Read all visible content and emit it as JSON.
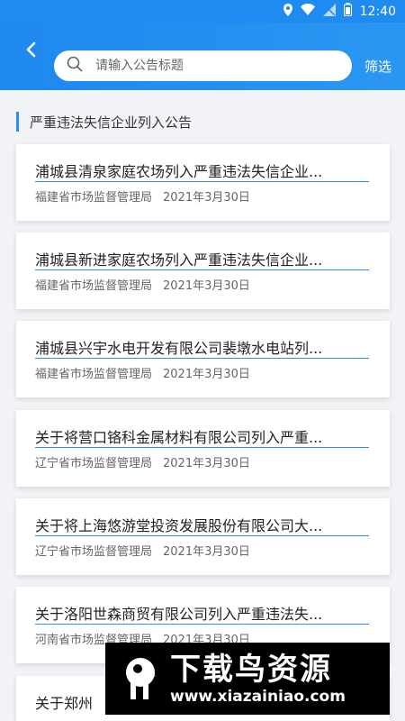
{
  "status_bar": {
    "time": "12:40"
  },
  "header": {
    "search_placeholder": "请输入公告标题",
    "filter_label": "筛选"
  },
  "section": {
    "title": "严重违法失信企业列入公告"
  },
  "items": [
    {
      "title": "浦城县清泉家庭农场列入严重违法失信企业...",
      "source": "福建省市场监督管理局",
      "date": "2021年3月30日"
    },
    {
      "title": "浦城县新进家庭农场列入严重违法失信企业...",
      "source": "福建省市场监督管理局",
      "date": "2021年3月30日"
    },
    {
      "title": "浦城县兴宇水电开发有限公司裴墩水电站列...",
      "source": "福建省市场监督管理局",
      "date": "2021年3月30日"
    },
    {
      "title": "关于将营口铬科金属材料有限公司列入严重...",
      "source": "辽宁省市场监督管理局",
      "date": "2021年3月30日"
    },
    {
      "title": "关于将上海悠游堂投资发展股份有限公司大...",
      "source": "辽宁省市场监督管理局",
      "date": "2021年3月30日"
    },
    {
      "title": "关于洛阳世森商贸有限公司列入严重违法失...",
      "source": "河南省市场监督管理局",
      "date": "2021年3月30日"
    },
    {
      "title": "关于郑州",
      "source": "",
      "date": ""
    }
  ],
  "watermark": {
    "main_text": "下载鸟资源",
    "url_text": "www.xiazainiao.com"
  },
  "colors": {
    "accent": "#1f8af0",
    "underline": "#2e8ef0",
    "background": "#f2f3f7"
  }
}
